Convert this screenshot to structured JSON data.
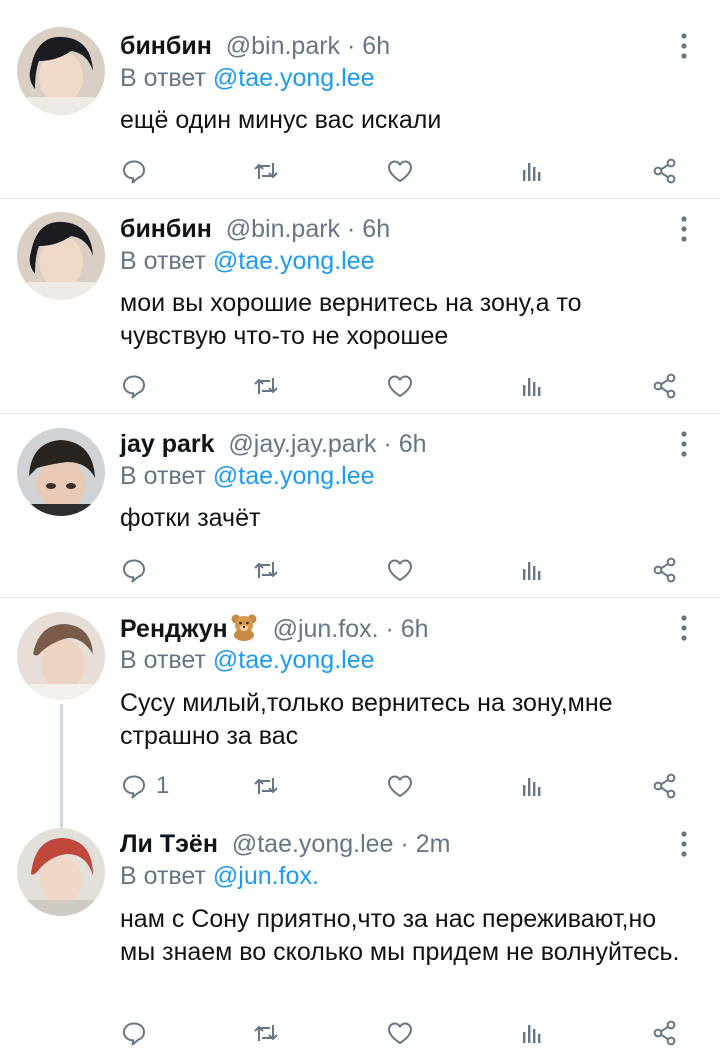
{
  "tweets": [
    {
      "name": "бинбин",
      "handle": "@bin.park",
      "time": "6h",
      "reply_prefix": "В ответ",
      "reply_to": "@tae.yong.lee",
      "text": "ещё один минус вас искали",
      "reply_count": ""
    },
    {
      "name": "бинбин",
      "handle": "@bin.park",
      "time": "6h",
      "reply_prefix": "В ответ",
      "reply_to": "@tae.yong.lee",
      "text": "мои вы хорошие вернитесь на зону,а то чувствую что-то не хорошее",
      "reply_count": ""
    },
    {
      "name": "jay park",
      "handle": "@jay.jay.park",
      "time": "6h",
      "reply_prefix": "В ответ",
      "reply_to": "@tae.yong.lee",
      "text": "фотки зачёт",
      "reply_count": ""
    },
    {
      "name": "Ренджун",
      "name_emoji": "teddy-bear-emoji",
      "handle": "@jun.fox.",
      "time": "6h",
      "reply_prefix": "В ответ",
      "reply_to": "@tae.yong.lee",
      "text": "Сусу милый,только вернитесь на зону,мне страшно за вас",
      "reply_count": "1"
    },
    {
      "name": "Ли Тэён",
      "handle": "@tae.yong.lee",
      "time": "2m",
      "reply_prefix": "В ответ",
      "reply_to": "@jun.fox.",
      "text": "нам с Сону приятно,что за нас переживают,но мы знаем во сколько мы придем не волнуйтесь.",
      "reply_count": ""
    }
  ],
  "separator": "·",
  "colors": {
    "mention": "#1d9bf0",
    "secondary_text": "#657786",
    "divider": "#e1e6ea",
    "thread_line": "#cfd9de"
  },
  "icons": [
    "reply-icon",
    "retweet-icon",
    "like-icon",
    "stats-icon",
    "share-icon",
    "more-vertical-icon"
  ]
}
